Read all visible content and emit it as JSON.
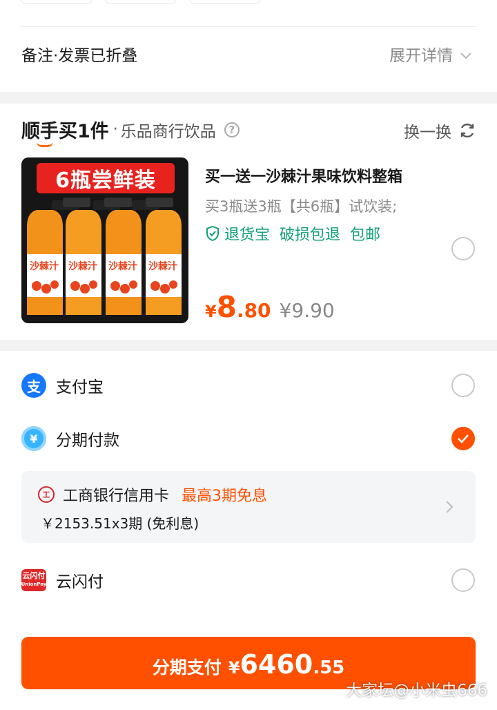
{
  "remarks": {
    "label": "备注·发票已折叠",
    "expand_label": "展开详情"
  },
  "addon": {
    "brand": "顺手买1件",
    "separator": "·",
    "shop": "乐品商行饮品",
    "help_icon": "question-circle-icon",
    "swap_label": "换一换"
  },
  "product": {
    "image_banner": "6瓶尝鲜装",
    "image_bottle_label": "沙棘汁",
    "title": "买一送一沙棘汁果味饮料整箱",
    "subtitle": "买3瓶送3瓶【共6瓶】试饮装;",
    "tags": [
      "退货宝",
      "破损包退",
      "包邮"
    ],
    "price": {
      "currency": "¥",
      "integer": "8",
      "decimal": ".80",
      "original": "¥9.90"
    },
    "selected": false
  },
  "payment": {
    "methods": [
      {
        "label": "支付宝",
        "icon": "alipay-icon",
        "selected": false
      },
      {
        "label": "分期付款",
        "icon": "huabei-installment-icon",
        "selected": true
      },
      {
        "label": "云闪付",
        "icon": "unionpay-icon",
        "selected": false
      }
    ],
    "installment": {
      "bank": "工商银行信用卡",
      "promo": "最高3期免息",
      "detail": "￥2153.51x3期 (免利息)"
    }
  },
  "submit": {
    "label": "分期支付",
    "currency": "¥",
    "amount_integer": "6460",
    "amount_decimal": ".55"
  },
  "watermark": "大家坛@小米虫666",
  "colors": {
    "accent": "#ff5000",
    "green": "#12a07a",
    "alipay": "#1677ff"
  }
}
